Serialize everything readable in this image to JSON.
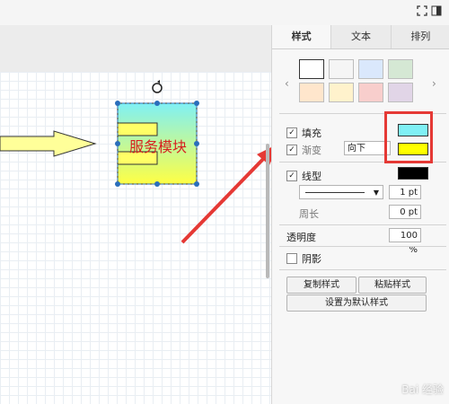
{
  "tabs": [
    {
      "label": "样式",
      "active": true
    },
    {
      "label": "文本",
      "active": false
    },
    {
      "label": "排列",
      "active": false
    }
  ],
  "palette": {
    "swatches": [
      "#ffffff",
      "#f5f5f5",
      "#dae8fc",
      "#d5e8d4",
      "#ffe6cc",
      "#fff2cc",
      "#f8cecc",
      "#e1d5e7"
    ]
  },
  "canvas": {
    "shape_label": "服务模块",
    "shape_gradient": [
      "#7ff0f5",
      "#ffff44"
    ]
  },
  "style": {
    "fill_label": "填充",
    "fill_checked": true,
    "fill_color": "#7ff0f5",
    "gradient_label": "渐变",
    "gradient_checked": true,
    "gradient_direction": "向下",
    "gradient_color": "#ffff00",
    "line_label": "线型",
    "line_checked": true,
    "line_color": "#000000",
    "line_width": "1 pt",
    "perimeter_label": "周长",
    "perimeter_value": "0 pt",
    "opacity_label": "透明度",
    "opacity_value": "100 %",
    "shadow_label": "阴影",
    "shadow_checked": false
  },
  "buttons": {
    "copy_style": "复制样式",
    "paste_style": "粘贴样式",
    "set_default": "设置为默认样式"
  },
  "watermark": "Bai 经验"
}
